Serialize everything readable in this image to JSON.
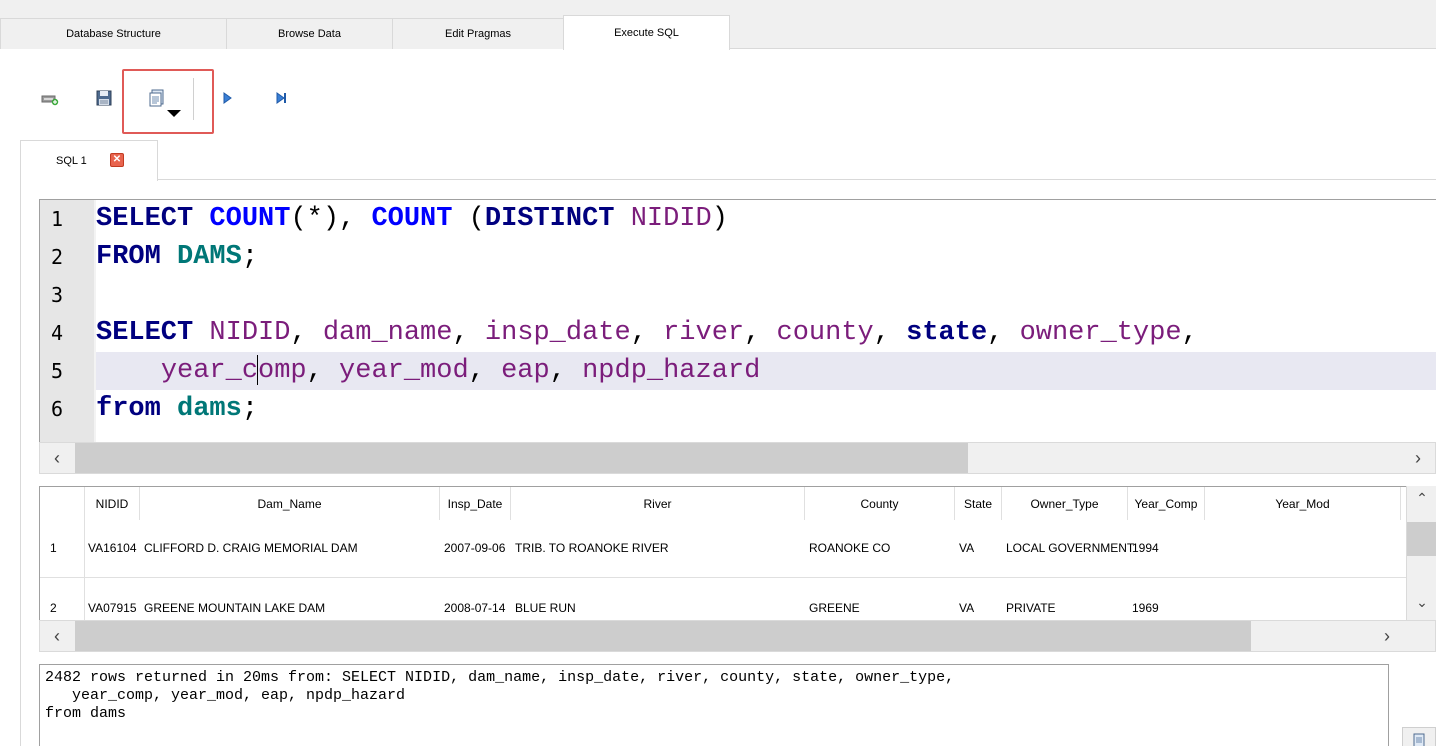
{
  "tabs": [
    {
      "label": "Database Structure",
      "active": false
    },
    {
      "label": "Browse Data",
      "active": false
    },
    {
      "label": "Edit Pragmas",
      "active": false
    },
    {
      "label": "Execute SQL",
      "active": true
    }
  ],
  "toolbar": {
    "icons": [
      "open-tab-icon",
      "save-sql-icon",
      "save-results-icon",
      "execute-all-icon",
      "execute-line-icon"
    ],
    "highlight_color": "#e05a57"
  },
  "sql_tab": {
    "label": "SQL 1",
    "close_glyph": "✕"
  },
  "editor": {
    "line_numbers": [
      "1",
      "2",
      "3",
      "4",
      "5",
      "6"
    ],
    "lines": [
      "SELECT COUNT(*), COUNT (DISTINCT NIDID)",
      "FROM DAMS;",
      "",
      "SELECT NIDID, dam_name, insp_date, river, county, state, owner_type,",
      "    year_comp, year_mod, eap, npdp_hazard",
      "from dams;"
    ]
  },
  "results": {
    "columns": [
      "NIDID",
      "Dam_Name",
      "Insp_Date",
      "River",
      "County",
      "State",
      "Owner_Type",
      "Year_Comp",
      "Year_Mod"
    ],
    "rows": [
      {
        "num": "1",
        "cells": [
          "VA16104",
          "CLIFFORD D. CRAIG MEMORIAL DAM",
          "2007-09-06",
          "TRIB. TO ROANOKE RIVER",
          "ROANOKE CO",
          "VA",
          "LOCAL GOVERNMENT",
          "1994",
          ""
        ]
      },
      {
        "num": "2",
        "cells": [
          "VA07915",
          "GREENE MOUNTAIN LAKE DAM",
          "2008-07-14",
          "BLUE RUN",
          "GREENE",
          "VA",
          "PRIVATE",
          "1969",
          ""
        ]
      }
    ]
  },
  "message": {
    "text": "2482 rows returned in 20ms from: SELECT NIDID, dam_name, insp_date, river, county, state, owner_type,\n   year_comp, year_mod, eap, npdp_hazard\nfrom dams"
  },
  "colors": {
    "keyword": "#00007f",
    "function": "#0000ff",
    "identifier": "#7b1d7b",
    "table": "#007777"
  }
}
